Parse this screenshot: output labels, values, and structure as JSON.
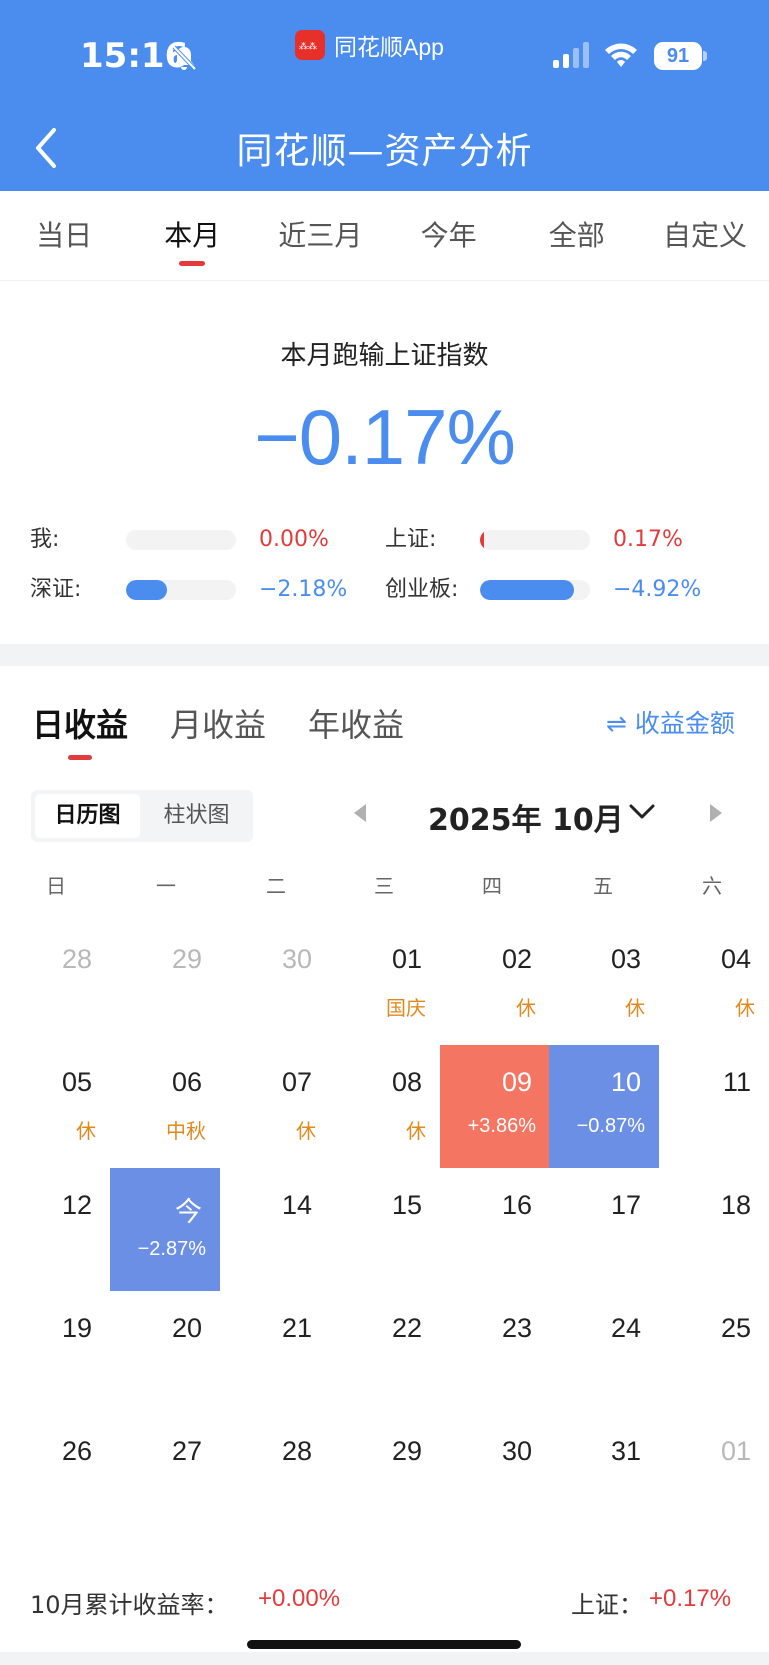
{
  "status_bar": {
    "time": "15:16",
    "app_name": "同花顺App",
    "battery": "91",
    "icons": [
      "bell-slash-icon",
      "signal-icon",
      "wifi-icon",
      "battery-icon"
    ]
  },
  "header": {
    "title": "同花顺—资产分析",
    "back_icon": "chevron-left-icon",
    "background": "#4a8def"
  },
  "period_tabs": [
    {
      "label": "当日",
      "active": false
    },
    {
      "label": "本月",
      "active": true
    },
    {
      "label": "近三月",
      "active": false
    },
    {
      "label": "今年",
      "active": false
    },
    {
      "label": "全部",
      "active": false
    },
    {
      "label": "自定义",
      "active": false
    }
  ],
  "summary": {
    "title": "本月跑输上证指数",
    "value": "−0.17%",
    "comparisons": [
      {
        "label": "我:",
        "value": "0.00%",
        "level": 0.0,
        "color": "#e33b3b"
      },
      {
        "label": "上证:",
        "value": "0.17%",
        "level": 0.03,
        "color": "#e33b3b"
      },
      {
        "label": "深证:",
        "value": "−2.18%",
        "level": 0.37,
        "color": "#4a8def"
      },
      {
        "label": "创业板:",
        "value": "−4.92%",
        "level": 0.85,
        "color": "#4a8def"
      }
    ]
  },
  "returns": {
    "tabs": [
      {
        "label": "日收益",
        "active": true
      },
      {
        "label": "月收益",
        "active": false
      },
      {
        "label": "年收益",
        "active": false
      }
    ],
    "amount_toggle": "⇌ 收益金额",
    "view_switch": [
      {
        "label": "日历图",
        "active": true
      },
      {
        "label": "柱状图",
        "active": false
      }
    ],
    "month_label": "2025年 10月"
  },
  "calendar": {
    "weekdays": [
      "日",
      "一",
      "二",
      "三",
      "四",
      "五",
      "六"
    ],
    "weeks": [
      [
        {
          "day": "28",
          "muted": true
        },
        {
          "day": "29",
          "muted": true
        },
        {
          "day": "30",
          "muted": true
        },
        {
          "day": "01",
          "note": "国庆"
        },
        {
          "day": "02",
          "note": "休"
        },
        {
          "day": "03",
          "note": "休"
        },
        {
          "day": "04",
          "note": "休"
        }
      ],
      [
        {
          "day": "05",
          "note": "休"
        },
        {
          "day": "06",
          "note": "中秋"
        },
        {
          "day": "07",
          "note": "休"
        },
        {
          "day": "08",
          "note": "休"
        },
        {
          "day": "09",
          "note": "+3.86%",
          "state": "up"
        },
        {
          "day": "10",
          "note": "−0.87%",
          "state": "down"
        },
        {
          "day": "11"
        }
      ],
      [
        {
          "day": "12"
        },
        {
          "day": "今",
          "note": "−2.87%",
          "state": "down"
        },
        {
          "day": "14"
        },
        {
          "day": "15"
        },
        {
          "day": "16"
        },
        {
          "day": "17"
        },
        {
          "day": "18"
        }
      ],
      [
        {
          "day": "19"
        },
        {
          "day": "20"
        },
        {
          "day": "21"
        },
        {
          "day": "22"
        },
        {
          "day": "23"
        },
        {
          "day": "24"
        },
        {
          "day": "25"
        }
      ],
      [
        {
          "day": "26"
        },
        {
          "day": "27"
        },
        {
          "day": "28"
        },
        {
          "day": "29"
        },
        {
          "day": "30"
        },
        {
          "day": "31"
        },
        {
          "day": "01",
          "muted": true
        }
      ]
    ]
  },
  "footer": {
    "cumulative_label": "10月累计收益率：",
    "cumulative_value": "+0.00%",
    "index_label": "上证：",
    "index_value": "+0.17%"
  }
}
